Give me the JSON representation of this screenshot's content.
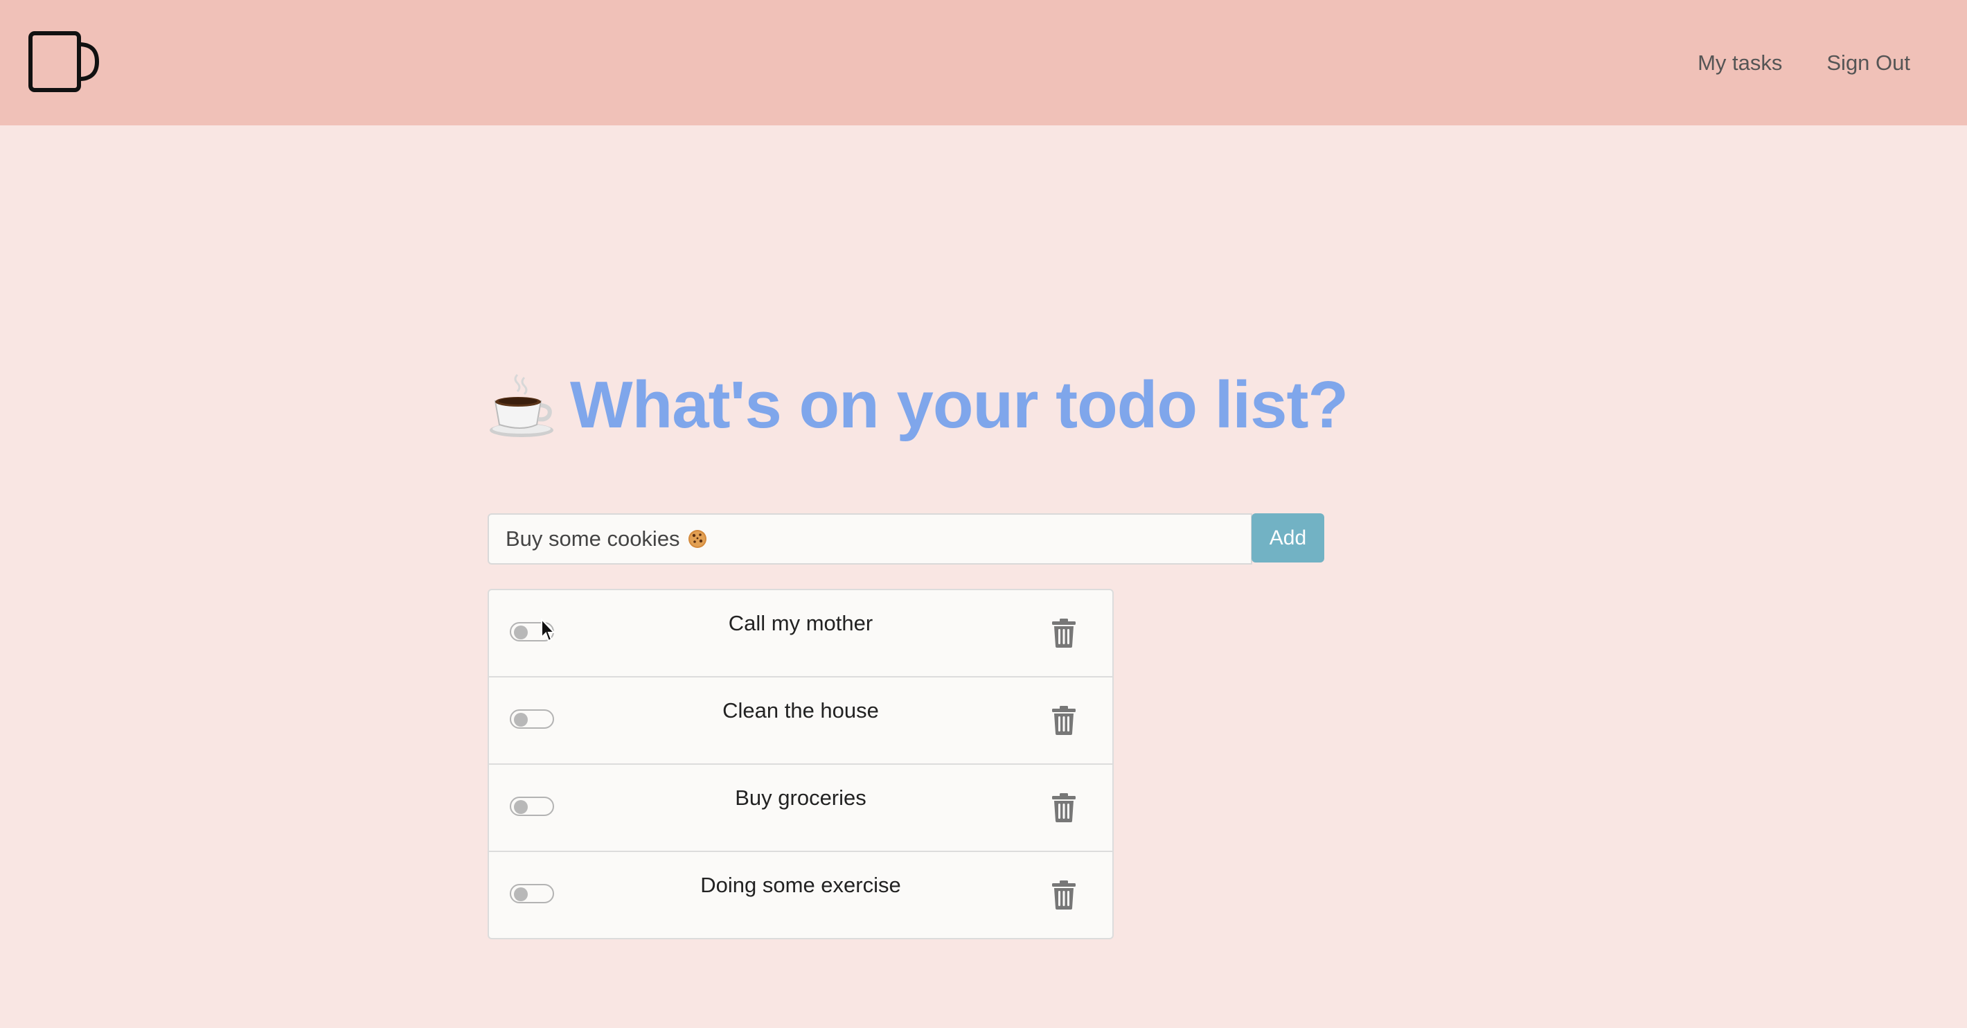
{
  "nav": {
    "logo_icon": "mug-icon",
    "links": [
      "My tasks",
      "Sign Out"
    ]
  },
  "hero": {
    "emoji_icon": "hot-beverage-icon",
    "title": "What's on your todo list?",
    "title_color": "#7fa6eb"
  },
  "form": {
    "input_value": "Buy some cookies",
    "input_icon": "cookie-icon",
    "add_label": "Add",
    "add_color": "#72b2c4"
  },
  "todos": [
    {
      "text": "Call my mother",
      "done": false
    },
    {
      "text": "Clean the house",
      "done": false
    },
    {
      "text": "Buy groceries",
      "done": false
    },
    {
      "text": "Doing some exercise",
      "done": false
    }
  ],
  "colors": {
    "navbar": "#f0c1b8",
    "background": "#f9e6e3"
  }
}
